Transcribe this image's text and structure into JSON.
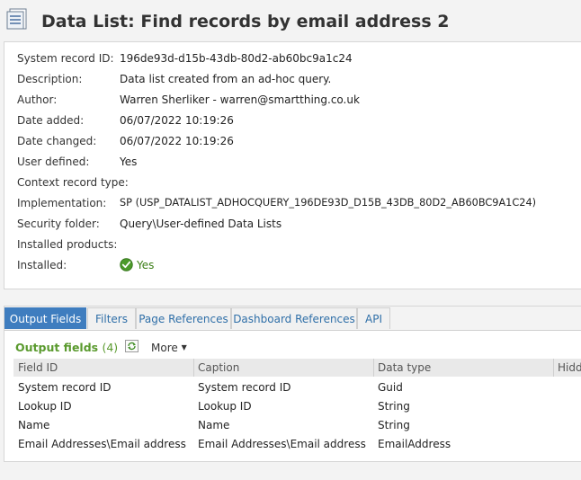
{
  "page": {
    "title": "Data List: Find records by email address 2"
  },
  "details": [
    {
      "label": "System record ID:",
      "value": "196de93d-d15b-43db-80d2-ab60bc9a1c24"
    },
    {
      "label": "Description:",
      "value": "Data list created from an ad-hoc query."
    },
    {
      "label": "Author:",
      "value": "Warren Sherliker - warren@smartthing.co.uk"
    },
    {
      "label": "Date added:",
      "value": "06/07/2022 10:19:26"
    },
    {
      "label": "Date changed:",
      "value": "06/07/2022 10:19:26"
    },
    {
      "label": "User defined:",
      "value": "Yes"
    },
    {
      "label": "Context record type:",
      "value": ""
    },
    {
      "label": "Implementation:",
      "value": "SP (USP_DATALIST_ADHOCQUERY_196DE93D_D15B_43DB_80D2_AB60BC9A1C24)"
    },
    {
      "label": "Security folder:",
      "value": "Query\\User-defined Data Lists"
    },
    {
      "label": "Installed products:",
      "value": ""
    },
    {
      "label": "Installed:",
      "value": "Yes"
    }
  ],
  "tabs": [
    "Output Fields",
    "Filters",
    "Page References",
    "Dashboard References",
    "API"
  ],
  "output_section": {
    "title": "Output fields",
    "count": "(4)",
    "more_label": "More",
    "columns": [
      "Field ID",
      "Caption",
      "Data type",
      "Hidd"
    ],
    "rows": [
      [
        "System record ID",
        "System record ID",
        "Guid"
      ],
      [
        "Lookup ID",
        "Lookup ID",
        "String"
      ],
      [
        "Name",
        "Name",
        "String"
      ],
      [
        "Email Addresses\\Email address",
        "Email Addresses\\Email address",
        "EmailAddress"
      ]
    ]
  },
  "colors": {
    "accent": "#3f7dbf",
    "section_title": "#5a9a2e",
    "success": "#3a7d14"
  },
  "icons": {
    "title": "data-list-icon",
    "installed": "check-circle-icon",
    "refresh": "refresh-icon",
    "more": "caret-down-icon"
  }
}
